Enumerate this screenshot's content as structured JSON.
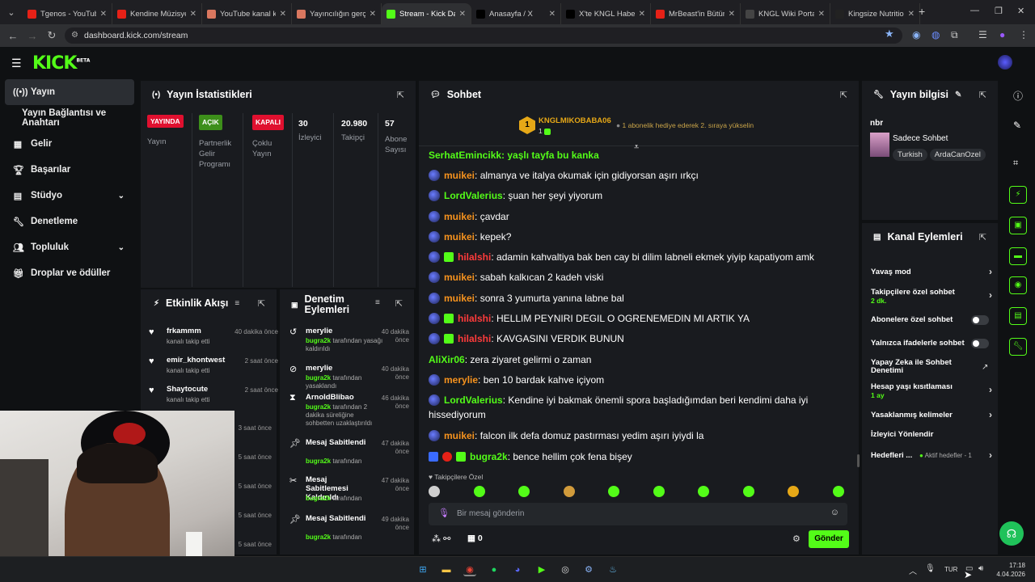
{
  "browser": {
    "tabs": [
      {
        "label": "Tgenos - YouTube",
        "color": "#e62117"
      },
      {
        "label": "Kendine Müzisyen",
        "color": "#e62117"
      },
      {
        "label": "YouTube kanal kü",
        "color": "#d9775f"
      },
      {
        "label": "Yayıncılığın gerçe",
        "color": "#d9775f"
      },
      {
        "label": "Stream - Kick Das",
        "color": "#53fc18"
      },
      {
        "label": "Anasayfa / X",
        "color": "#000000"
      },
      {
        "label": "X'te KNGL Haber",
        "color": "#000000"
      },
      {
        "label": "MrBeast'in Bütün",
        "color": "#e62117"
      },
      {
        "label": "KNGL Wiki Portal",
        "color": "#444444"
      },
      {
        "label": "Kingsize Nutrition",
        "color": "#222222"
      }
    ],
    "active_tab": 4,
    "url": "dashboard.kick.com/stream"
  },
  "nav": {
    "items": [
      {
        "label": "Yayın",
        "icon": "broadcast-icon"
      },
      {
        "label": "Yayın Bağlantısı ve Anahtarı",
        "icon": ""
      },
      {
        "label": "Gelir",
        "icon": "dollar-icon"
      },
      {
        "label": "Başarılar",
        "icon": "trophy-icon"
      },
      {
        "label": "Stüdyo",
        "icon": "studio-icon"
      },
      {
        "label": "Denetleme",
        "icon": "wrench-icon"
      },
      {
        "label": "Topluluk",
        "icon": "users-icon"
      },
      {
        "label": "Droplar ve ödüller",
        "icon": "gift-icon"
      }
    ]
  },
  "stats": {
    "title": "Yayın İstatistikleri",
    "live_badge": "YAYINDA",
    "live_label": "Yayın",
    "partner_badge": "AÇIK",
    "partner_label": "Partnerlik Gelir Programı",
    "multi_badge": "KAPALI",
    "multi_label": "Çoklu Yayın",
    "viewers": "30",
    "viewers_label": "İzleyici",
    "followers": "20.980",
    "followers_label": "Takipçi",
    "subs": "57",
    "subs_label": "Abone Sayısı"
  },
  "activity": {
    "title": "Etkinlik Akışı",
    "items": [
      {
        "name": "frkammm",
        "sub": "kanalı takip etti",
        "time": "40 dakika önce"
      },
      {
        "name": "emir_khontwest",
        "sub": "kanalı takip etti",
        "time": "2 saat önce"
      },
      {
        "name": "Shaytocute",
        "sub": "kanalı takip etti",
        "time": "2 saat önce"
      }
    ],
    "hidden_times": [
      "3 saat önce",
      "5 saat önce",
      "5 saat önce",
      "5 saat önce",
      "5 saat önce"
    ]
  },
  "modlog": {
    "title": "Denetim Eylemleri",
    "items": [
      {
        "name": "merylie",
        "by": "bugra2k",
        "sub": " tarafından yasağı kaldırıldı",
        "time": "40 dakika önce"
      },
      {
        "name": "merylie",
        "by": "bugra2k",
        "sub": " tarafından yasaklandı",
        "time": "40 dakika önce"
      },
      {
        "name": "ArnoldBlibao",
        "by": "bugra2k",
        "sub": " tarafından 2 dakika süreliğine sohbetten uzaklaştırıldı",
        "time": "46 dakika önce"
      },
      {
        "name": "Mesaj Sabitlendi",
        "by": "bugra2k",
        "sub": " tarafından",
        "time": "47 dakika önce"
      },
      {
        "name": "Mesaj Sabitlemesi Kaldırıldı",
        "by": "bugra2k",
        "sub": " tarafından",
        "time": "47 dakika önce"
      },
      {
        "name": "Mesaj Sabitlendi",
        "by": "bugra2k",
        "sub": " tarafından",
        "time": "49 dakika önce"
      }
    ]
  },
  "chat": {
    "title": "Sohbet",
    "pinned_user": "KNGLMIKOBABA06",
    "pinned_count": "1",
    "gift_text": "1 abonelik hediye ederek 2. sıraya yükselin",
    "partial_top": "SerhatEmincikk: yaşlı tayfa bu kanka",
    "messages": [
      {
        "user": "muikei",
        "color": "#f7931e",
        "text": "almanya ve italya okumak için gidiyorsan aşırı ırkçı"
      },
      {
        "user": "LordValerius",
        "color": "#53fc18",
        "text": "şuan her şeyi yiyorum"
      },
      {
        "user": "muikei",
        "color": "#f7931e",
        "text": "çavdar"
      },
      {
        "user": "muikei",
        "color": "#f7931e",
        "text": "kepek?"
      },
      {
        "user": "hilalshi",
        "color": "#ff3b3b",
        "text": "adamin kahvaltiya bak ben cay bi dilim labneli ekmek yiyip kapatiyom amk"
      },
      {
        "user": "muikei",
        "color": "#f7931e",
        "text": "sabah kalkıcan 2 kadeh viski"
      },
      {
        "user": "muikei",
        "color": "#f7931e",
        "text": "sonra 3 yumurta yanına labne bal"
      },
      {
        "user": "hilalshi",
        "color": "#ff3b3b",
        "text": "HELLIM PEYNIRI DEGIL O OGRENEMEDIN MI ARTIK YA"
      },
      {
        "user": "hilalshi",
        "color": "#ff3b3b",
        "text": "KAVGASINI VERDIK BUNUN"
      },
      {
        "user": "AliXir06",
        "color": "#53fc18",
        "text": "zera ziyaret gelirmi o zaman"
      },
      {
        "user": "merylie",
        "color": "#f7931e",
        "text": "ben 10 bardak kahve içiyom"
      },
      {
        "user": "LordValerius",
        "color": "#53fc18",
        "text": "Kendine iyi bakmak önemli spora başladığımdan beri kendimi daha iyi hissediyorum"
      },
      {
        "user": "muikei",
        "color": "#f7931e",
        "text": "falcon ilk defa domuz pastırması yedim aşırı iyiydi la"
      },
      {
        "user": "bugra2k",
        "color": "#53fc18",
        "text": "bence hellim çok fena bişey"
      }
    ],
    "followers_only": "Takipçilere Özel",
    "placeholder": "Bir mesaj gönderin",
    "points": "0",
    "send": "Gönder"
  },
  "info": {
    "title": "Yayın bilgisi",
    "name": "nbr",
    "category": "Sadece Sohbet",
    "tags": [
      "Turkish",
      "ArdaCanOzel"
    ]
  },
  "channel": {
    "title": "Kanal Eylemleri",
    "slow": "Yavaş mod",
    "followers_chat": "Takipçilere özel sohbet",
    "followers_sub": "2 dk.",
    "subs_chat": "Abonelere özel sohbet",
    "emote_chat": "Yalnızca ifadelerle sohbet",
    "ai_mod": "Yapay Zeka ile Sohbet Denetimi",
    "age": "Hesap yaşı kısıtlaması",
    "age_sub": "1 ay",
    "banned_words": "Yasaklanmış kelimeler",
    "redirect": "İzleyici Yönlendir",
    "goals": "Hedefleri ...",
    "goals_sub": "Aktif hedefler - 1"
  },
  "taskbar": {
    "lang": "TUR",
    "time": "17:18",
    "date": "4.04.2026"
  }
}
